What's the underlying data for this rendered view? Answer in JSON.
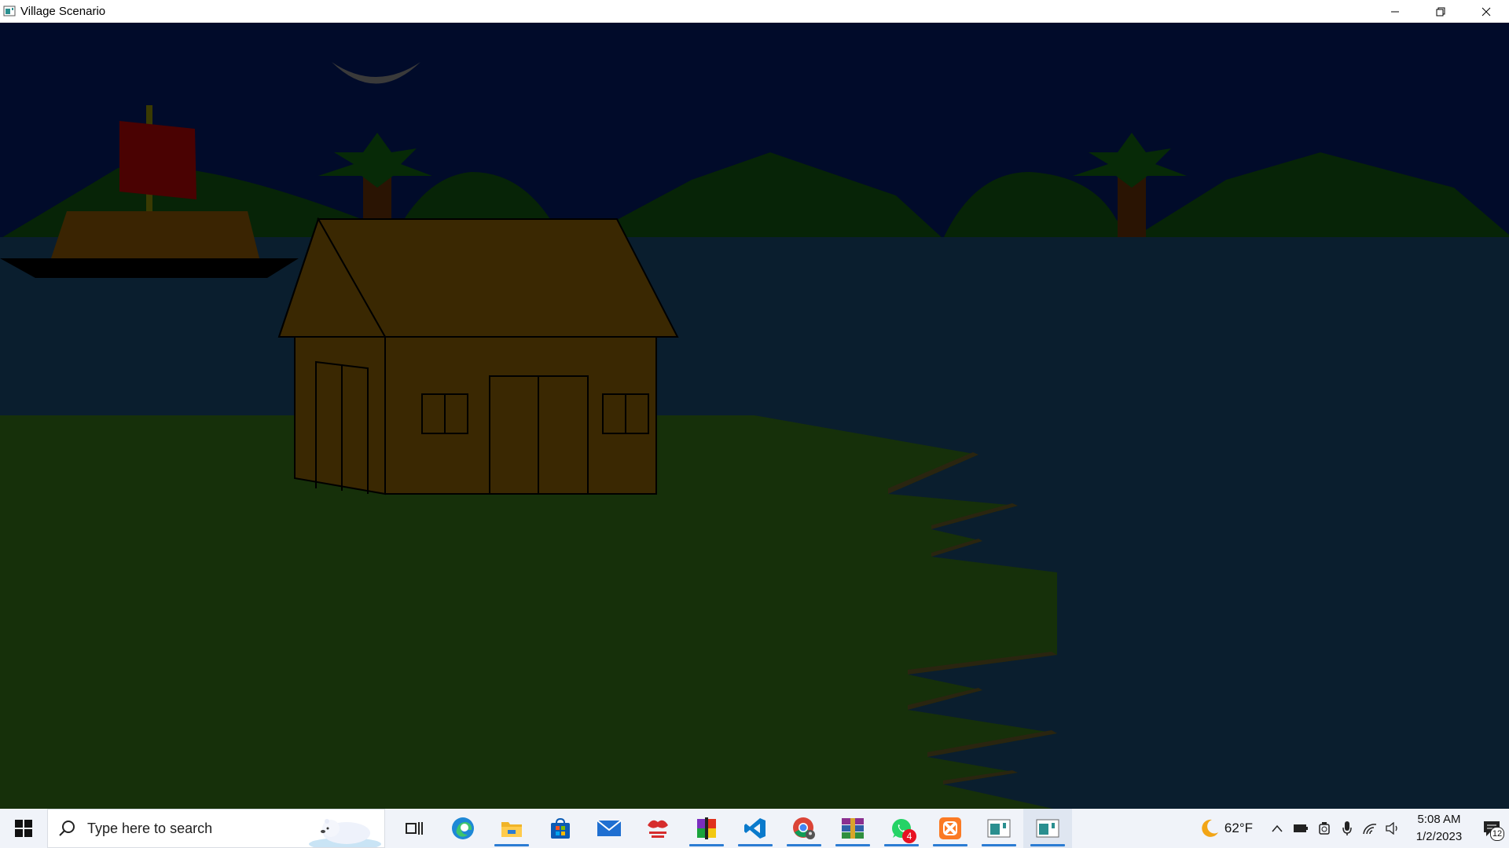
{
  "window": {
    "title": "Village Scenario",
    "controls": {
      "minimize_icon": "minimize-icon",
      "restore_icon": "restore-icon",
      "close_icon": "close-icon"
    }
  },
  "scene": {
    "colors": {
      "sky": "#010b2a",
      "hills": "#072407",
      "water": "#0a1e2e",
      "ground": "#16300a",
      "house_wall": "#3a2802",
      "house_roof": "#3a2802",
      "boat_hull": "#3a2402",
      "boat_base": "#000000",
      "sail": "#4a0202",
      "mast": "#3a3a02",
      "palm_trunk": "#2a1403",
      "palm_leaves": "#072a07",
      "moon": "#3a3a3a",
      "shore_shadow": "#2a2510"
    }
  },
  "taskbar": {
    "search_placeholder": "Type here to search",
    "apps": [
      {
        "name": "task-view-icon",
        "active": false
      },
      {
        "name": "edge-icon",
        "active": false
      },
      {
        "name": "file-explorer-icon",
        "active": true
      },
      {
        "name": "store-icon",
        "active": false
      },
      {
        "name": "mail-icon",
        "active": false
      },
      {
        "name": "app-bengali-icon",
        "active": false
      },
      {
        "name": "winrar-color-icon",
        "active": true
      },
      {
        "name": "vscode-icon",
        "active": true
      },
      {
        "name": "chrome-icon",
        "active": true
      },
      {
        "name": "winrar-icon",
        "active": true
      },
      {
        "name": "whatsapp-icon",
        "active": true,
        "badge": "4"
      },
      {
        "name": "xampp-icon",
        "active": true
      },
      {
        "name": "window-app-icon",
        "active": true
      },
      {
        "name": "window-app-icon",
        "active": true
      }
    ],
    "weather": {
      "icon": "moon-icon",
      "temp": "62°F"
    },
    "tray_icons": [
      "chevron-up-icon",
      "battery-icon",
      "camera-icon",
      "microphone-icon",
      "wifi-icon",
      "volume-icon"
    ],
    "clock": {
      "time": "5:08 AM",
      "date": "1/2/2023"
    },
    "notifications": {
      "icon": "notification-icon",
      "count": "12"
    }
  }
}
